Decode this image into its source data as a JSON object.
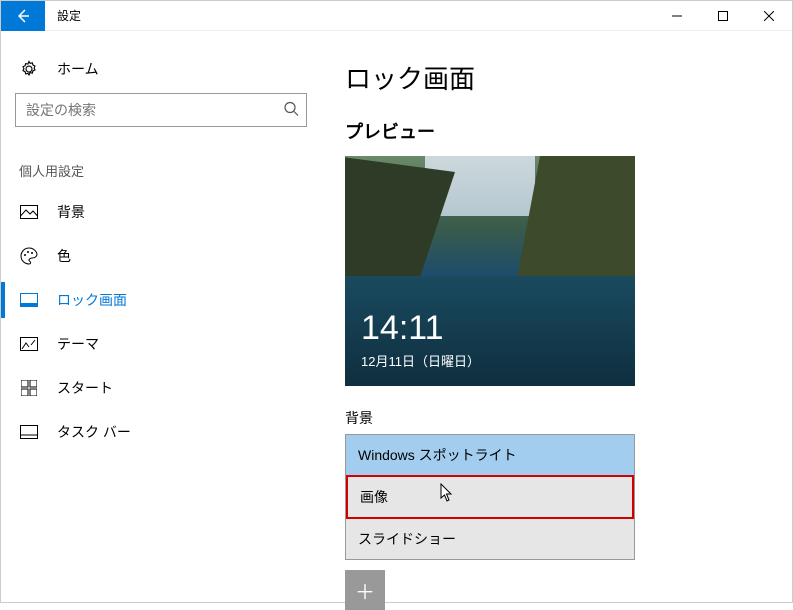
{
  "titlebar": {
    "title": "設定"
  },
  "sidebar": {
    "home": "ホーム",
    "search_placeholder": "設定の検索",
    "category": "個人用設定",
    "items": [
      {
        "label": "背景"
      },
      {
        "label": "色"
      },
      {
        "label": "ロック画面"
      },
      {
        "label": "テーマ"
      },
      {
        "label": "スタート"
      },
      {
        "label": "タスク バー"
      }
    ]
  },
  "main": {
    "page_title": "ロック画面",
    "preview_label": "プレビュー",
    "time": "14:11",
    "date": "12月11日（日曜日）",
    "background_label": "背景",
    "dropdown": {
      "selected": "Windows スポットライト",
      "options": [
        "Windows スポットライト",
        "画像",
        "スライドショー"
      ]
    }
  }
}
